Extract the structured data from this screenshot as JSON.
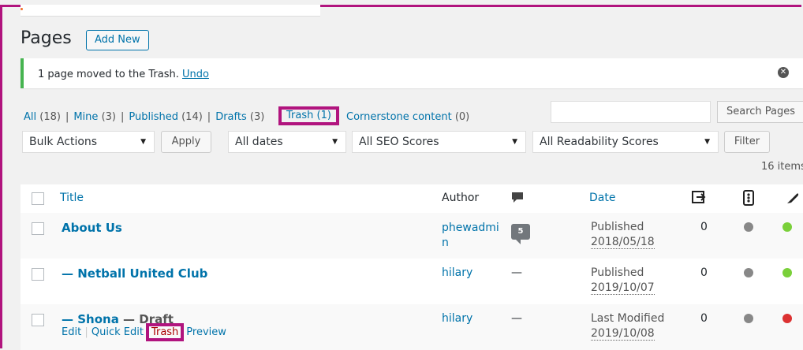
{
  "page": {
    "title": "Pages",
    "add_new": "Add New"
  },
  "notice": {
    "message": "1 page moved to the Trash.",
    "undo": "Undo",
    "dismiss_icon": "dismiss-icon"
  },
  "filters": {
    "all": "All",
    "all_count": "(18)",
    "mine": "Mine",
    "mine_count": "(3)",
    "published": "Published",
    "published_count": "(14)",
    "drafts": "Drafts",
    "drafts_count": "(3)",
    "trash": "Trash",
    "trash_count": "(1)",
    "cornerstone": "Cornerstone content",
    "cornerstone_count": "(0)",
    "separator": "|"
  },
  "search": {
    "button": "Search Pages",
    "value": ""
  },
  "toolbar": {
    "bulk_actions": "Bulk Actions",
    "apply": "Apply",
    "dates": "All dates",
    "seo": "All SEO Scores",
    "readability": "All Readability Scores",
    "filter": "Filter",
    "items_count": "16 items"
  },
  "columns": {
    "title": "Title",
    "author": "Author",
    "comments_icon": "comment-icon",
    "date": "Date",
    "links_icon": "links-icon",
    "seo_icon": "seo-traffic-light-icon",
    "readability_icon": "readability-feather-icon"
  },
  "rows": [
    {
      "title": "About Us",
      "author_line1": "phewadmi",
      "author_line2": "n",
      "comments": "5",
      "status": "Published",
      "date": "2018/05/18",
      "links": "0",
      "seo_color": "#888888",
      "readability_color": "#7ad03a"
    },
    {
      "title": "— Netball United Club",
      "author_line1": "hilary",
      "comments": "—",
      "status": "Published",
      "date": "2019/10/07",
      "links": "0",
      "seo_color": "#888888",
      "readability_color": "#7ad03a"
    },
    {
      "title_main": "— Shona",
      "title_state": " — Draft",
      "author_line1": "hilary",
      "comments": "—",
      "status": "Last Modified",
      "date": "2019/10/08",
      "links": "0",
      "seo_color": "#888888",
      "readability_color": "#dc3232",
      "actions": {
        "edit": "Edit",
        "quick_edit": "Quick Edit",
        "trash": "Trash",
        "preview": "Preview",
        "sep": "|"
      }
    }
  ]
}
